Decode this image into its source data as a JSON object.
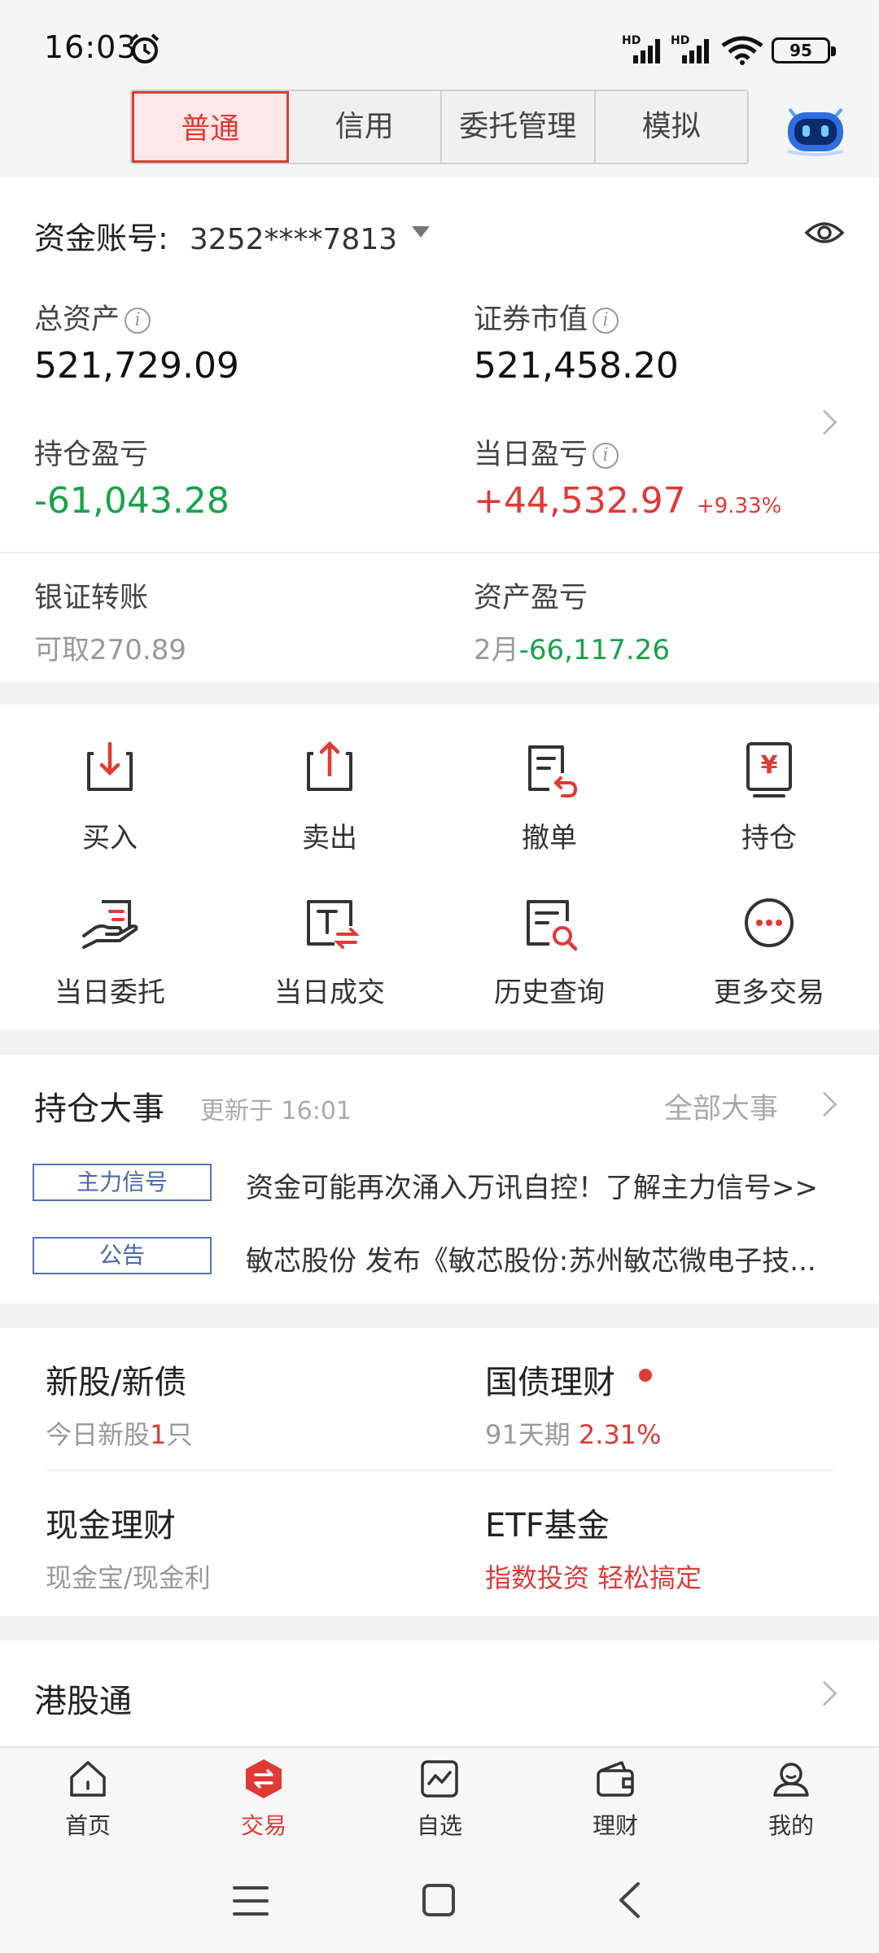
{
  "status": {
    "time": "16:03",
    "hd1": "HD",
    "hd2": "HD",
    "battery": "95"
  },
  "tabs": [
    "普通",
    "信用",
    "委托管理",
    "模拟"
  ],
  "account": {
    "label": "资金账号:",
    "number": "3252****7813",
    "total_assets_label": "总资产",
    "total_assets": "521,729.09",
    "market_value_label": "证券市值",
    "market_value": "521,458.20",
    "position_pl_label": "持仓盈亏",
    "position_pl": "-61,043.28",
    "daily_pl_label": "当日盈亏",
    "daily_pl": "+44,532.97",
    "daily_pl_pct": "+9.33%",
    "transfer_label": "银证转账",
    "withdrawable_prefix": "可取",
    "withdrawable": "270.89",
    "asset_pl_label": "资产盈亏",
    "asset_pl_month": "2月",
    "asset_pl": "-66,117.26",
    "info_glyph": "i"
  },
  "actions": [
    {
      "label": "买入",
      "icon": "buy-icon"
    },
    {
      "label": "卖出",
      "icon": "sell-icon"
    },
    {
      "label": "撤单",
      "icon": "cancel-order-icon"
    },
    {
      "label": "持仓",
      "icon": "holdings-icon"
    },
    {
      "label": "当日委托",
      "icon": "today-orders-icon"
    },
    {
      "label": "当日成交",
      "icon": "today-deals-icon"
    },
    {
      "label": "历史查询",
      "icon": "history-query-icon"
    },
    {
      "label": "更多交易",
      "icon": "more-trade-icon"
    }
  ],
  "news": {
    "title": "持仓大事",
    "updated": "更新于 16:01",
    "all_label": "全部大事",
    "items": [
      {
        "tag": "主力信号",
        "text": "资金可能再次涌入万讯自控！了解主力信号>>"
      },
      {
        "tag": "公告",
        "text": "敏芯股份 发布《敏芯股份:苏州敏芯微电子技..."
      }
    ]
  },
  "products": {
    "ipo_title": "新股/新债",
    "ipo_sub_a": "今日新股",
    "ipo_sub_count": "1",
    "ipo_sub_b": "只",
    "bond_title": "国债理财",
    "bond_term": "91天期",
    "bond_rate": "2.31%",
    "cash_title": "现金理财",
    "cash_sub": "现金宝/现金利",
    "etf_title": "ETF基金",
    "etf_sub": "指数投资 轻松搞定"
  },
  "hk": {
    "title": "港股通"
  },
  "nav": [
    "首页",
    "交易",
    "自选",
    "理财",
    "我的"
  ],
  "colors": {
    "accent": "#e03a36",
    "green": "#17a34a",
    "tag_blue": "#4a69a8"
  }
}
